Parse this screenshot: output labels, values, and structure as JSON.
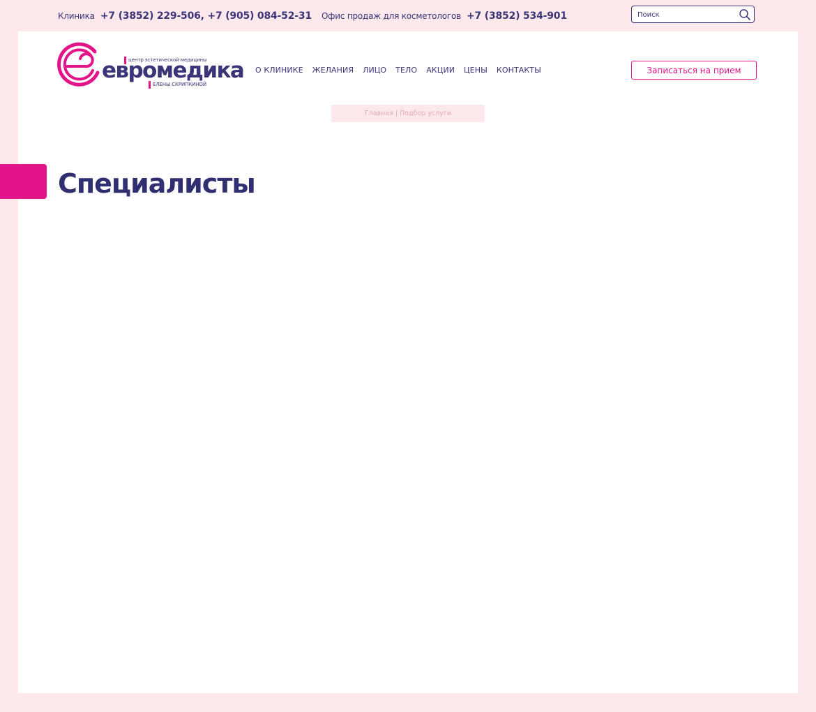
{
  "topbar": {
    "clinic_label": "Клиника",
    "clinic_phones": "+7 (3852) 229-506, +7 (905) 084-52-31",
    "office_label": "Офис продаж для косметологов",
    "office_phone": "+7 (3852) 534-901"
  },
  "search": {
    "placeholder": "Поиск",
    "icon": "search-icon"
  },
  "logo": {
    "tagline_top": "центр эстетической медицины",
    "name": "евромедика",
    "tagline_bottom": "ЕЛЕНЫ СКРИПКИНОЙ"
  },
  "nav": {
    "items": [
      {
        "label": "О КЛИНИКЕ"
      },
      {
        "label": "ЖЕЛАНИЯ"
      },
      {
        "label": "ЛИЦО"
      },
      {
        "label": "ТЕЛО"
      },
      {
        "label": "АКЦИИ"
      },
      {
        "label": "ЦЕНЫ"
      },
      {
        "label": "КОНТАКТЫ"
      }
    ]
  },
  "cta": {
    "label": "Записаться на прием"
  },
  "breadcrumb": {
    "home": "Главная",
    "separator": "|",
    "current": "Подбор услуги"
  },
  "page": {
    "title": "Специалисты"
  },
  "colors": {
    "page_background": "#fde9ec",
    "primary": "#3a3478",
    "accent": "#e3148a",
    "panel": "#ffffff"
  }
}
